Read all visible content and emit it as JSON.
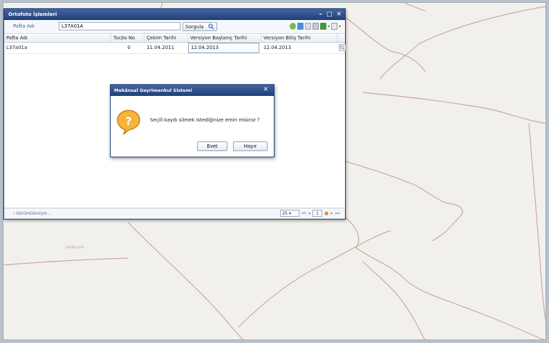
{
  "map": {
    "label": "MAKKLAN"
  },
  "window": {
    "title": "Ortofoto İşlemleri",
    "controls": [
      "–",
      "□",
      "✕"
    ],
    "toolbar": {
      "label": "Pafta Adı",
      "input_value": "L37A01A",
      "search_label": "Sorgula"
    },
    "columns": [
      "Pafta Adı",
      "Tucbs No",
      "Çekim Tarihi",
      "Versiyon Başlanıç Tarihi",
      "Versiyon Bitiş Tarihi"
    ],
    "rows": [
      [
        "L37a01a",
        "0",
        "11.04.2011",
        "12.04.2013",
        "12.04.2013"
      ]
    ],
    "footer": {
      "status": "Görüntüleniyor...",
      "page_size": "25",
      "current_page": "1"
    }
  },
  "dialog": {
    "title": "Mekânsal Gayrimenkul Sistemi",
    "close": "✕",
    "message": "Seçili kaydı silmek istediğinize emin misiniz ?",
    "yes_label": "Evet",
    "no_label": "Hayır"
  },
  "colors": {
    "titlebar": "#1f3f78",
    "map_bg": "#f2f0ec",
    "road": "#c9a89a",
    "warning_icon": "#f0a020"
  }
}
